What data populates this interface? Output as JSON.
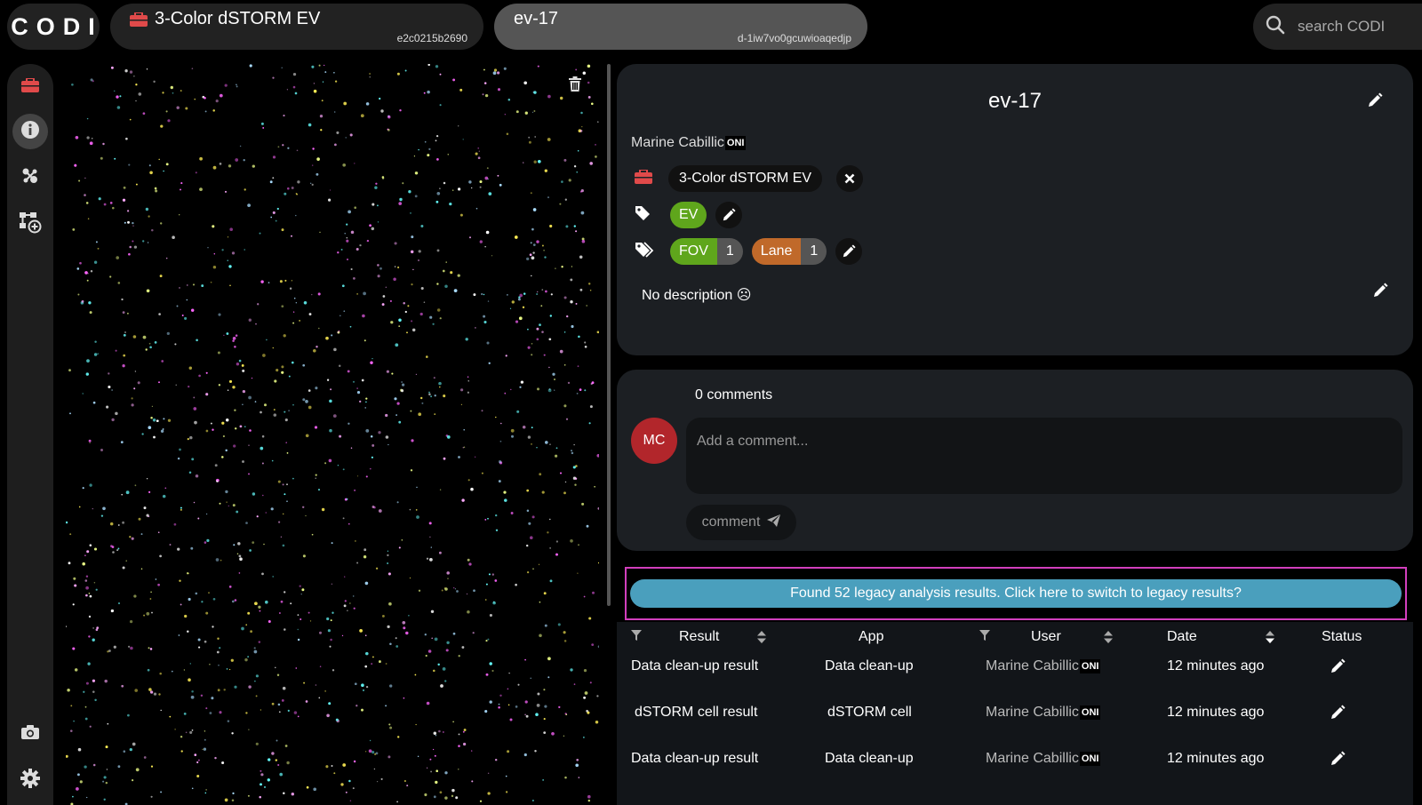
{
  "app": {
    "logo": "CODI"
  },
  "tabs": [
    {
      "title": "3-Color dSTORM EV",
      "id": "e2c0215b2690",
      "icon": "briefcase-icon"
    },
    {
      "title": "ev-17",
      "id": "d-1iw7vo0gcuwioaqedjp"
    }
  ],
  "search": {
    "placeholder": "search CODI"
  },
  "sidebar": {
    "items": [
      "briefcase-icon",
      "info-icon",
      "analysis-icon",
      "add-pipeline-icon"
    ],
    "bottom": [
      "camera-icon",
      "gear-icon"
    ]
  },
  "viewer": {
    "trash_icon": "trash-icon"
  },
  "info": {
    "title": "ev-17",
    "owner": "Marine Cabillic",
    "owner_badge": "ONI",
    "project": "3-Color dSTORM EV",
    "tag": "EV",
    "pairs": [
      {
        "key": "FOV",
        "value": "1",
        "color": "#5fa61c"
      },
      {
        "key": "Lane",
        "value": "1",
        "color": "#c0692a"
      }
    ],
    "description": "No description ☹"
  },
  "comments": {
    "count": "0 comments",
    "avatar": "MC",
    "placeholder": "Add a comment...",
    "button": "comment"
  },
  "legacy": {
    "text": "Found 52 legacy analysis results. Click here to switch to legacy results?"
  },
  "results": {
    "headers": {
      "result": "Result",
      "app": "App",
      "user": "User",
      "date": "Date",
      "status": "Status"
    },
    "rows": [
      {
        "result": "Data clean-up result",
        "app": "Data clean-up",
        "user": "Marine Cabillic",
        "badge": "ONI",
        "date": "12 minutes ago"
      },
      {
        "result": "dSTORM cell result",
        "app": "dSTORM cell",
        "user": "Marine Cabillic",
        "badge": "ONI",
        "date": "12 minutes ago"
      },
      {
        "result": "Data clean-up result",
        "app": "Data clean-up",
        "user": "Marine Cabillic",
        "badge": "ONI",
        "date": "12 minutes ago"
      }
    ]
  },
  "colors": {
    "accent_legacy": "#4a9fbd",
    "highlight_border": "#d23fbd",
    "avatar": "#b2262b",
    "briefcase": "#e04a4a"
  }
}
